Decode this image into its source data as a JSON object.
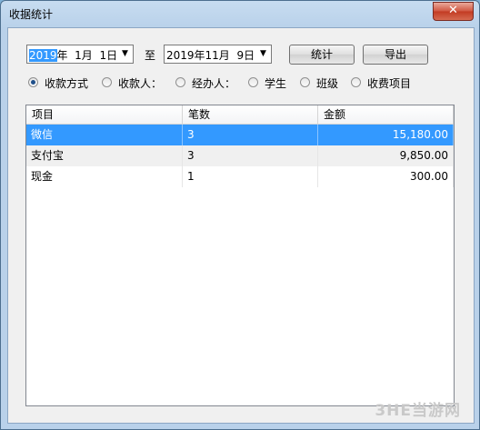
{
  "window": {
    "title": "收据统计",
    "close_glyph": "✕"
  },
  "filters": {
    "start_date": {
      "selected": "2019",
      "rest": "年  1月  1日"
    },
    "to_label": "至",
    "end_date": {
      "value": "2019年11月  9日"
    },
    "dropdown_glyph": "▼",
    "stats_button": "统计",
    "export_button": "导出"
  },
  "group_by": {
    "options": [
      {
        "label": "收款方式",
        "checked": true
      },
      {
        "label": "收款人：",
        "checked": false
      },
      {
        "label": "经办人：",
        "checked": false
      },
      {
        "label": "学生",
        "checked": false
      },
      {
        "label": "班级",
        "checked": false
      },
      {
        "label": "收费项目",
        "checked": false
      }
    ]
  },
  "table": {
    "columns": [
      "项目",
      "笔数",
      "金额"
    ],
    "rows": [
      {
        "item": "微信",
        "count": "3",
        "amount": "15,180.00",
        "selected": true
      },
      {
        "item": "支付宝",
        "count": "3",
        "amount": "9,850.00",
        "selected": false
      },
      {
        "item": "现金",
        "count": "1",
        "amount": "300.00",
        "selected": false
      }
    ]
  },
  "watermark": "3HE当游网",
  "colors": {
    "selection": "#3399ff",
    "title_bar": "#b9d1ea",
    "close_button": "#c23a22"
  }
}
